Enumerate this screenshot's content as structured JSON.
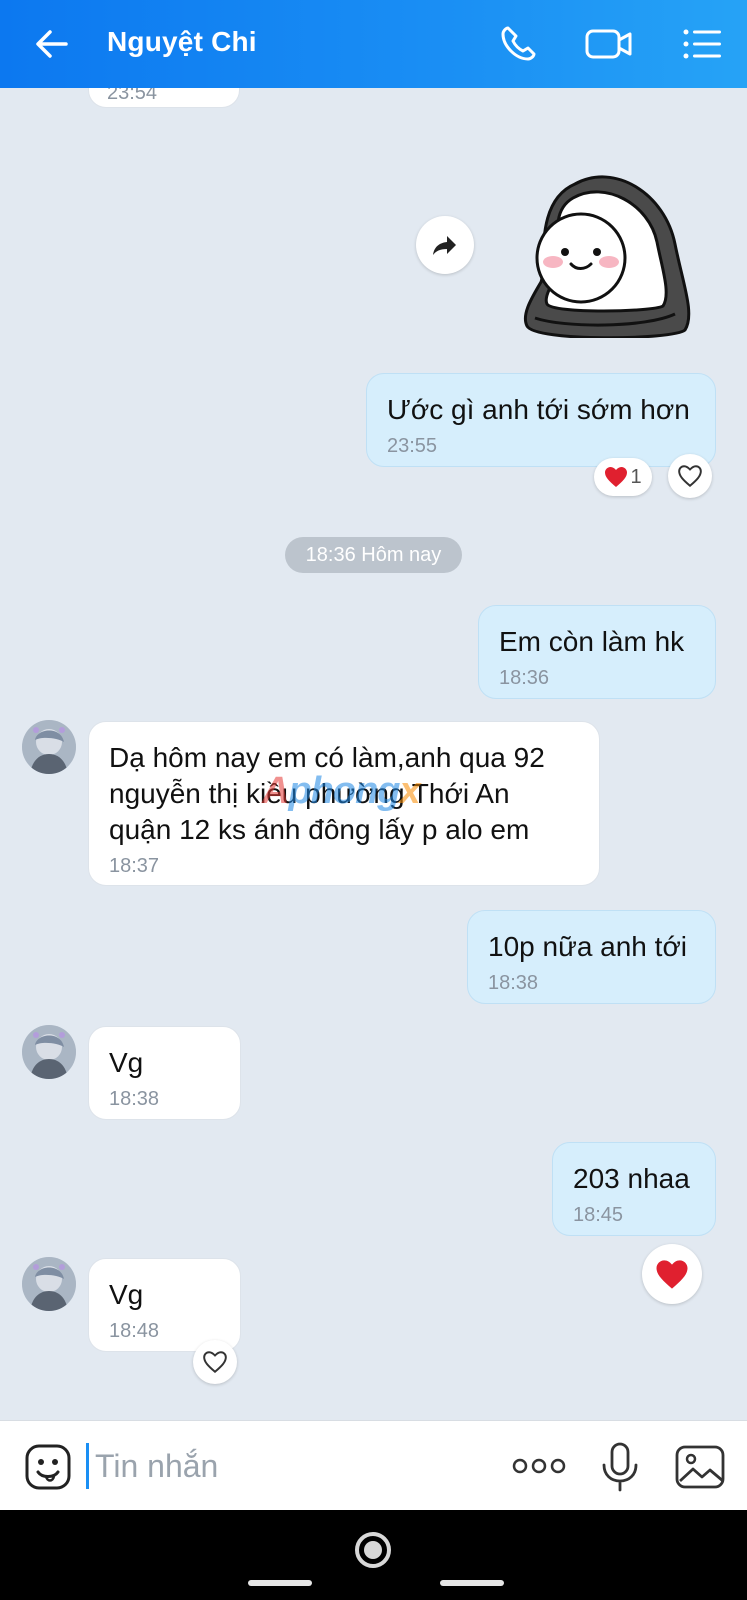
{
  "header": {
    "contact_name": "Nguyệt Chi",
    "icons": {
      "back": "arrow-left-icon",
      "call": "phone-icon",
      "video": "video-call-icon",
      "menu": "list-menu-icon"
    }
  },
  "messages": [
    {
      "id": "m0",
      "from": "them",
      "text": "",
      "time": "23:54"
    },
    {
      "id": "m1",
      "from": "me",
      "type": "sticker",
      "sticker": "hooded-cute-character"
    },
    {
      "id": "m2",
      "from": "me",
      "text": "Ước gì anh tới sớm hơn",
      "time": "23:55",
      "reactions": {
        "heart_count": "1"
      }
    },
    {
      "id": "m3",
      "from": "me",
      "text": "Em còn làm hk",
      "time": "18:36"
    },
    {
      "id": "m4",
      "from": "them",
      "text": "Dạ hôm nay em có làm,anh qua 92 nguyễn thị kiều phường Thới An quận 12 ks ánh đông lấy p alo em",
      "time": "18:37"
    },
    {
      "id": "m5",
      "from": "me",
      "text": "10p nữa anh tới",
      "time": "18:38"
    },
    {
      "id": "m6",
      "from": "them",
      "text": "Vg",
      "time": "18:38"
    },
    {
      "id": "m7",
      "from": "me",
      "text": "203 nhaa",
      "time": "18:45"
    },
    {
      "id": "m8",
      "from": "them",
      "text": "Vg",
      "time": "18:48"
    }
  ],
  "date_separator": "18:36 Hôm nay",
  "watermark": {
    "part1": "A",
    "part2": "phong",
    "part3": "x"
  },
  "input": {
    "placeholder": "Tin nhắn",
    "icons": {
      "emoji": "emoji-sticker-icon",
      "more": "more-dots-icon",
      "mic": "microphone-icon",
      "image": "image-gallery-icon"
    }
  },
  "colors": {
    "header_start": "#0c78f0",
    "header_end": "#26a3f6",
    "chat_bg": "#e2e9f1",
    "my_bubble": "#d6eefc",
    "heart": "#e0202f"
  }
}
